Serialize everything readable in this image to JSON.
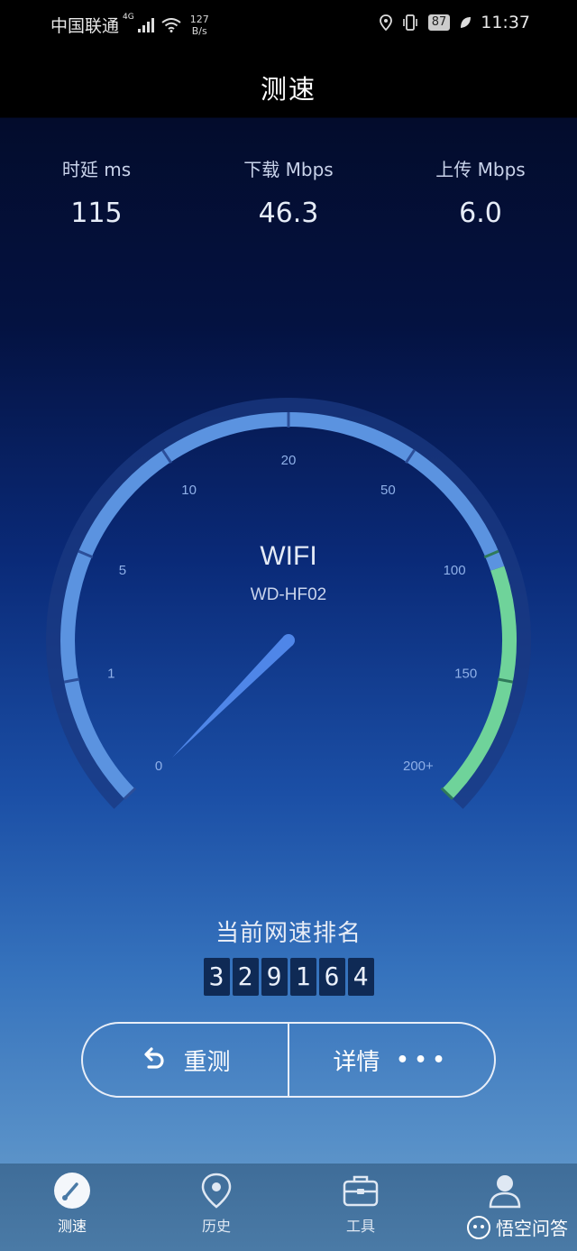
{
  "status": {
    "carrier": "中国联通",
    "network_type": "4G",
    "net_speed_value": "127",
    "net_speed_unit": "B/s",
    "battery": "87",
    "time": "11:37"
  },
  "header": {
    "title": "测速"
  },
  "metrics": [
    {
      "label": "时延 ms",
      "value": "115"
    },
    {
      "label": "下载 Mbps",
      "value": "46.3"
    },
    {
      "label": "上传 Mbps",
      "value": "6.0"
    }
  ],
  "gauge": {
    "network_name": "WIFI",
    "ssid": "WD-HF02",
    "tick_labels": [
      "0",
      "1",
      "5",
      "10",
      "20",
      "50",
      "100",
      "150",
      "200+"
    ],
    "colors": {
      "track": "#1d3b86",
      "arc_blue": "#5b93e0",
      "arc_green": "#6fd39a",
      "needle": "#4f86e8"
    }
  },
  "rank": {
    "title": "当前网速排名",
    "digits": [
      "3",
      "2",
      "9",
      "1",
      "6",
      "4"
    ]
  },
  "actions": {
    "retest_label": "重测",
    "details_label": "详情",
    "details_dots": "•••"
  },
  "nav": {
    "items": [
      {
        "label": "测速",
        "icon": "speedometer-icon"
      },
      {
        "label": "历史",
        "icon": "location-pin-icon"
      },
      {
        "label": "工具",
        "icon": "toolbox-icon"
      },
      {
        "label": "",
        "icon": "user-icon"
      }
    ]
  },
  "watermark": {
    "text": "悟空问答"
  }
}
